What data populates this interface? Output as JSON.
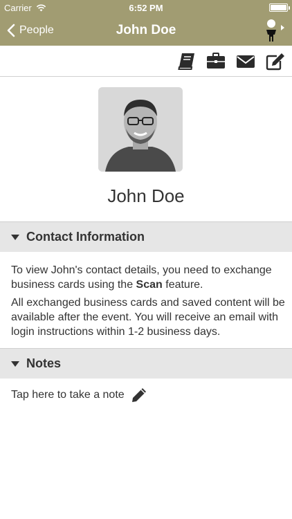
{
  "status_bar": {
    "carrier": "Carrier",
    "time": "6:52 PM"
  },
  "nav": {
    "back_label": "People",
    "title": "John Doe"
  },
  "actions": [
    {
      "icon": "book-icon"
    },
    {
      "icon": "briefcase-icon"
    },
    {
      "icon": "envelope-icon"
    },
    {
      "icon": "edit-icon"
    }
  ],
  "contact": {
    "name": "John Doe"
  },
  "contact_section": {
    "header": "Contact Information",
    "paragraph1_before": "To view John's contact details, you need to exchange business cards using the ",
    "paragraph1_bold": "Scan",
    "paragraph1_after": " feature.",
    "paragraph2": "All exchanged business cards and saved content will be available after the event. You will receive an email with login instructions within 1-2 business days."
  },
  "notes_section": {
    "header": "Notes",
    "prompt": "Tap here to take a note"
  },
  "colors": {
    "nav_bar": "#a19c72",
    "section_header": "#e6e6e6",
    "text": "#333333"
  }
}
